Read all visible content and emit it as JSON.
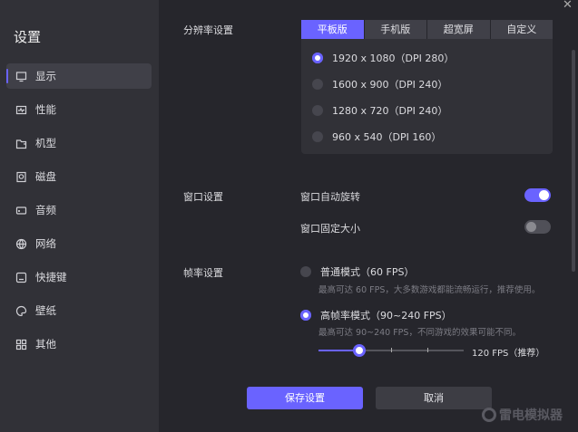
{
  "sidebar": {
    "title": "设置",
    "items": [
      {
        "label": "显示",
        "icon": "monitor-icon"
      },
      {
        "label": "性能",
        "icon": "performance-icon"
      },
      {
        "label": "机型",
        "icon": "device-icon"
      },
      {
        "label": "磁盘",
        "icon": "disk-icon"
      },
      {
        "label": "音频",
        "icon": "audio-icon"
      },
      {
        "label": "网络",
        "icon": "globe-icon"
      },
      {
        "label": "快捷键",
        "icon": "keyboard-icon"
      },
      {
        "label": "壁纸",
        "icon": "palette-icon"
      },
      {
        "label": "其他",
        "icon": "grid-icon"
      }
    ]
  },
  "resolution": {
    "label": "分辨率设置",
    "tabs": [
      "平板版",
      "手机版",
      "超宽屏",
      "自定义"
    ],
    "active_tab": 0,
    "options": [
      "1920 x 1080（DPI 280）",
      "1600 x 900（DPI 240）",
      "1280 x 720（DPI 240）",
      "960 x 540（DPI 160）"
    ],
    "selected": 0
  },
  "window": {
    "label": "窗口设置",
    "auto_rotate": "窗口自动旋转",
    "auto_rotate_on": true,
    "fixed_size": "窗口固定大小",
    "fixed_size_on": false
  },
  "fps": {
    "label": "帧率设置",
    "normal": "普通模式（60 FPS）",
    "normal_desc": "最高可达 60 FPS，大多数游戏都能流畅运行，推荐使用。",
    "high": "高帧率模式（90~240 FPS）",
    "high_desc": "最高可达 90~240 FPS，不同游戏的效果可能不同。",
    "selected": "high",
    "slider_value": "120 FPS（推荐）",
    "slider_fraction": 0.28
  },
  "buttons": {
    "save": "保存设置",
    "cancel": "取消"
  },
  "brand": "雷电模拟器",
  "colors": {
    "accent": "#6a63ff"
  }
}
